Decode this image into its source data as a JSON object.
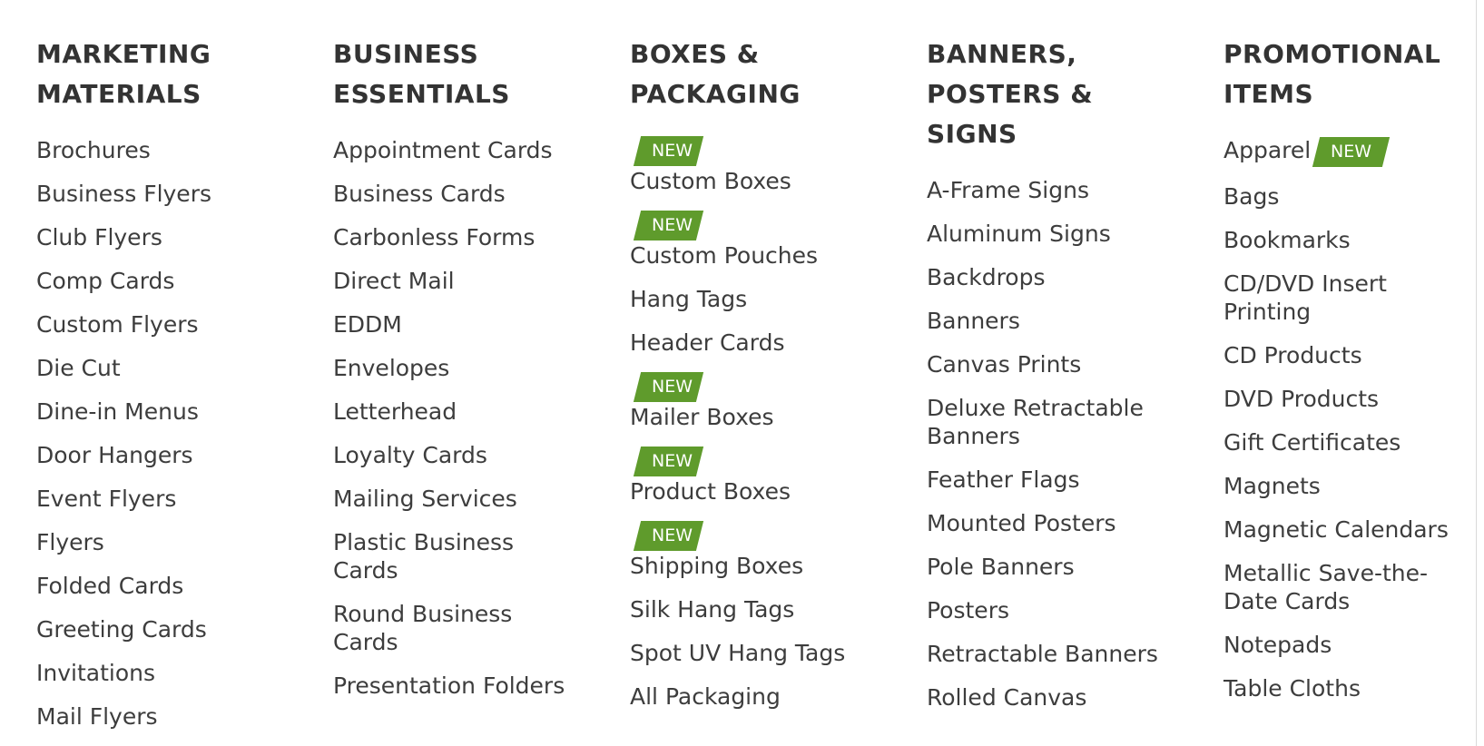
{
  "badge_label": "NEW",
  "colors": {
    "badge": "#5f9b2c",
    "heading": "#333333",
    "text": "#3d3d3d"
  },
  "columns": [
    {
      "heading": "MARKETING MATERIALS",
      "items": [
        {
          "label": "Brochures"
        },
        {
          "label": "Business Flyers"
        },
        {
          "label": "Club Flyers"
        },
        {
          "label": "Comp Cards"
        },
        {
          "label": "Custom Flyers"
        },
        {
          "label": "Die Cut"
        },
        {
          "label": "Dine-in Menus"
        },
        {
          "label": "Door Hangers"
        },
        {
          "label": "Event Flyers"
        },
        {
          "label": "Flyers"
        },
        {
          "label": "Folded Cards"
        },
        {
          "label": "Greeting Cards"
        },
        {
          "label": "Invitations"
        },
        {
          "label": "Mail Flyers"
        }
      ]
    },
    {
      "heading": "BUSINESS ESSENTIALS",
      "items": [
        {
          "label": "Appointment Cards"
        },
        {
          "label": "Business Cards"
        },
        {
          "label": "Carbonless Forms"
        },
        {
          "label": "Direct Mail"
        },
        {
          "label": "EDDM"
        },
        {
          "label": "Envelopes"
        },
        {
          "label": "Letterhead"
        },
        {
          "label": "Loyalty Cards"
        },
        {
          "label": "Mailing Services"
        },
        {
          "label": "Plastic Business Cards"
        },
        {
          "label": "Round Business Cards"
        },
        {
          "label": "Presentation Folders"
        }
      ]
    },
    {
      "heading": "BOXES & PACKAGING",
      "items": [
        {
          "label": "Custom Boxes",
          "badge": "above"
        },
        {
          "label": "Custom Pouches",
          "badge": "above"
        },
        {
          "label": "Hang Tags"
        },
        {
          "label": "Header Cards"
        },
        {
          "label": "Mailer Boxes",
          "badge": "above"
        },
        {
          "label": "Product Boxes",
          "badge": "above"
        },
        {
          "label": "Shipping Boxes",
          "badge": "above"
        },
        {
          "label": "Silk Hang Tags"
        },
        {
          "label": "Spot UV Hang Tags"
        },
        {
          "label": "All Packaging"
        }
      ]
    },
    {
      "heading": "BANNERS, POSTERS & SIGNS",
      "items": [
        {
          "label": "A-Frame Signs"
        },
        {
          "label": "Aluminum Signs"
        },
        {
          "label": "Backdrops"
        },
        {
          "label": "Banners"
        },
        {
          "label": "Canvas Prints"
        },
        {
          "label": "Deluxe Retractable Banners"
        },
        {
          "label": "Feather Flags"
        },
        {
          "label": "Mounted Posters"
        },
        {
          "label": "Pole Banners"
        },
        {
          "label": "Posters"
        },
        {
          "label": "Retractable Banners"
        },
        {
          "label": "Rolled Canvas"
        }
      ]
    },
    {
      "heading": "PROMOTIONAL ITEMS",
      "items": [
        {
          "label": "Apparel",
          "badge": "inline"
        },
        {
          "label": "Bags"
        },
        {
          "label": "Bookmarks"
        },
        {
          "label": "CD/DVD Insert Printing"
        },
        {
          "label": "CD Products"
        },
        {
          "label": "DVD Products"
        },
        {
          "label": "Gift Certificates"
        },
        {
          "label": "Magnets"
        },
        {
          "label": "Magnetic Calendars"
        },
        {
          "label": "Metallic Save-the-Date Cards"
        },
        {
          "label": "Notepads"
        },
        {
          "label": "Table Cloths"
        }
      ]
    }
  ]
}
